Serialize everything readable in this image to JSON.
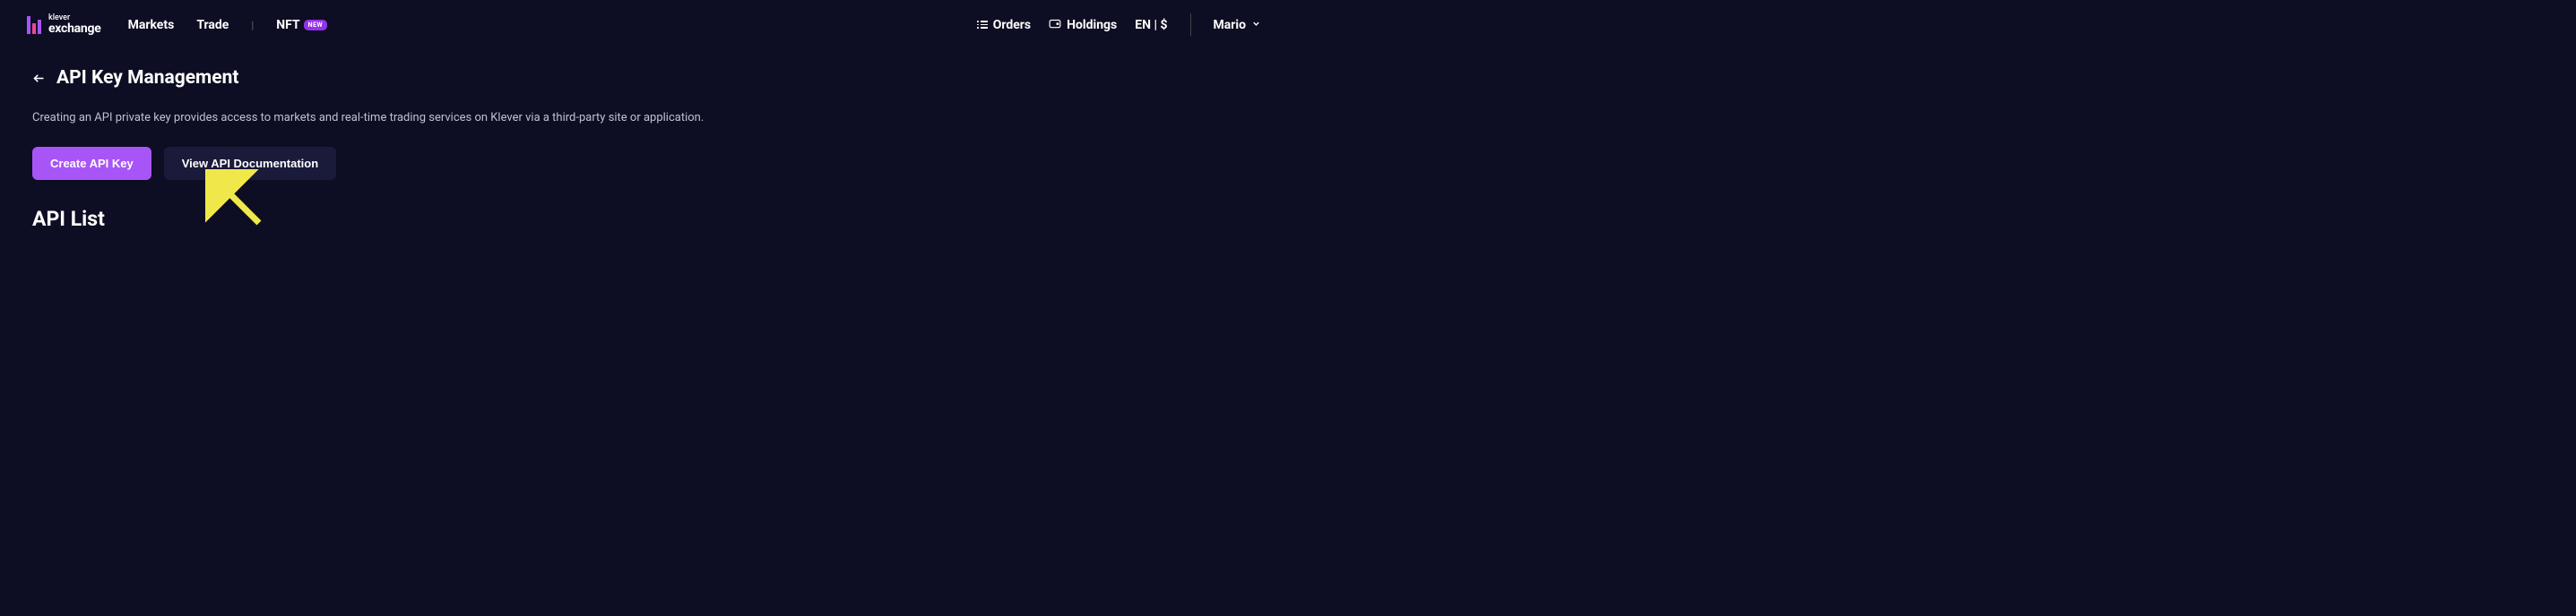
{
  "header": {
    "logo": {
      "text_top": "klever",
      "text_bottom": "exchange"
    },
    "nav": {
      "markets": "Markets",
      "trade": "Trade",
      "nft": "NFT",
      "new_badge": "NEW"
    },
    "right": {
      "orders": "Orders",
      "holdings": "Holdings",
      "locale": "EN | $",
      "username": "Mario"
    }
  },
  "page": {
    "title": "API Key Management",
    "description": "Creating an API private key provides access to markets and real-time trading services on Klever via a third-party site or application.",
    "create_button": "Create API Key",
    "docs_button": "View API Documentation",
    "section_title": "API List"
  }
}
